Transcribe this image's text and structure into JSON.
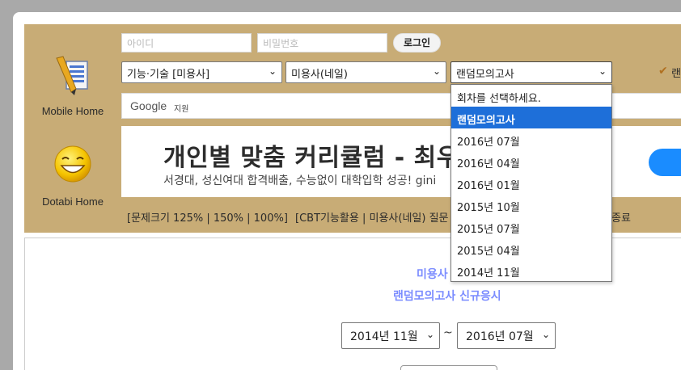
{
  "nav": {
    "mobile_home": "Mobile Home",
    "dotabi_home": "Dotabi Home"
  },
  "login": {
    "id_placeholder": "아이디",
    "pw_placeholder": "비밀번호",
    "login_button": "로그인"
  },
  "selects": {
    "category": "기능·기술 [미용사]",
    "subject": "미용사(네일)",
    "exam": "랜덤모의고사",
    "checkbox_label": "랜"
  },
  "search": {
    "brand": "Google",
    "sub": "지원"
  },
  "ad": {
    "title": "개인별 맞춤 커리큘럼 - 최우",
    "subtitle": "서경대, 성신여대 합격배출, 수능없이 대학입학 성공! gini"
  },
  "links": {
    "size": "[문제크기 125% | 150% | 100%]",
    "cbt": "[CBT기능활용 | 미용사(네일) 질문",
    "end": "종료"
  },
  "content": {
    "heading1": "미용사",
    "heading2": "랜덤모의고사 신규응시",
    "from": "2014년 11월",
    "to": "2016년 07월",
    "tilde": "~"
  },
  "dropdown": {
    "options": [
      "회차를 선택하세요.",
      "랜덤모의고사",
      "2016년 07월",
      "2016년 04월",
      "2016년 01월",
      "2015년 10월",
      "2015년 07월",
      "2015년 04월",
      "2014년 11월"
    ],
    "selected_index": 1
  },
  "colors": {
    "header_bg": "#c8ac76",
    "heading_color": "#7b8cff",
    "selected_bg": "#1e6fd9"
  }
}
